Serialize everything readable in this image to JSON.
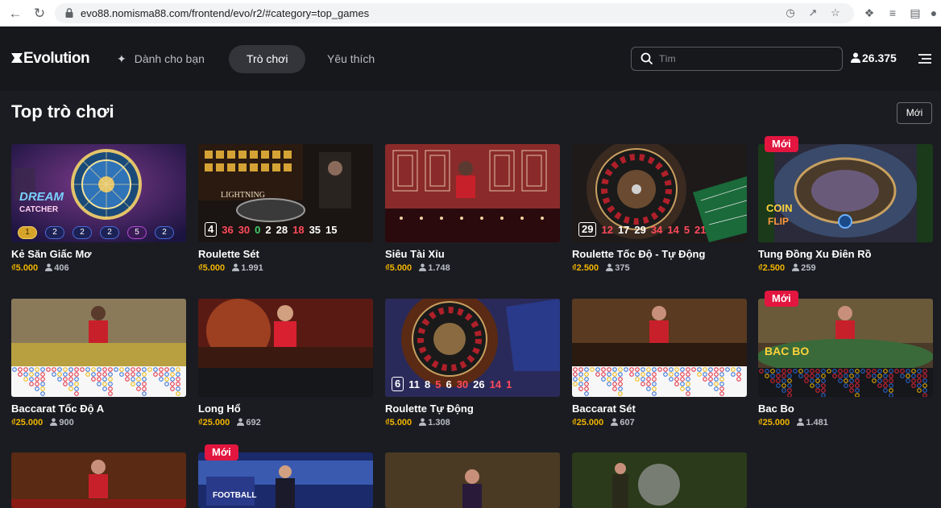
{
  "browser": {
    "url": "evo88.nomisma88.com/frontend/evo/r2/#category=top_games"
  },
  "header": {
    "logo": "Evolution",
    "nav": [
      {
        "label": "Dành cho bạn"
      },
      {
        "label": "Trò chơi"
      },
      {
        "label": "Yêu thích"
      }
    ],
    "search_placeholder": "Tìm",
    "players_total": "26.375"
  },
  "section": {
    "title": "Top trò chơi",
    "sort_button": "Mới"
  },
  "badge_new": "Mới",
  "games": [
    {
      "name": "Kẻ Săn Giấc Mơ",
      "bet": "₫5.000",
      "players": "406",
      "chips": [
        "1",
        "2",
        "2",
        "2",
        "5",
        "2"
      ]
    },
    {
      "name": "Roulette Sét",
      "bet": "₫5.000",
      "players": "1.991",
      "results": [
        "4",
        "36",
        "30",
        "0",
        "2",
        "28",
        "18",
        "35",
        "15"
      ]
    },
    {
      "name": "Siêu Tài Xỉu",
      "bet": "₫5.000",
      "players": "1.748"
    },
    {
      "name": "Roulette Tốc Độ - Tự Động",
      "bet": "₫2.500",
      "players": "375",
      "results": [
        "29",
        "12",
        "17",
        "29",
        "34",
        "14",
        "5",
        "21"
      ]
    },
    {
      "name": "Tung Đồng Xu Điên Rồ",
      "bet": "₫2.500",
      "players": "259",
      "is_new": true
    },
    {
      "name": "Baccarat Tốc Độ A",
      "bet": "₫25.000",
      "players": "900"
    },
    {
      "name": "Long Hổ",
      "bet": "₫25.000",
      "players": "692"
    },
    {
      "name": "Roulette Tự Động",
      "bet": "₫5.000",
      "players": "1.308",
      "results": [
        "6",
        "11",
        "8",
        "5",
        "6",
        "30",
        "26",
        "14",
        "1"
      ]
    },
    {
      "name": "Baccarat Sét",
      "bet": "₫25.000",
      "players": "607"
    },
    {
      "name": "Bac Bo",
      "bet": "₫25.000",
      "players": "1.481",
      "is_new": true
    },
    {
      "name": "",
      "bet": "",
      "players": ""
    },
    {
      "name": "",
      "bet": "",
      "players": "",
      "is_new": true
    },
    {
      "name": "",
      "bet": "",
      "players": ""
    },
    {
      "name": "",
      "bet": "",
      "players": ""
    }
  ],
  "colors": {
    "background": "#1b1c21",
    "header": "#17181c",
    "bet": "#f1b500",
    "badge": "#e2163f",
    "red_number": "#ff4a5a",
    "green_number": "#3fd06a"
  }
}
